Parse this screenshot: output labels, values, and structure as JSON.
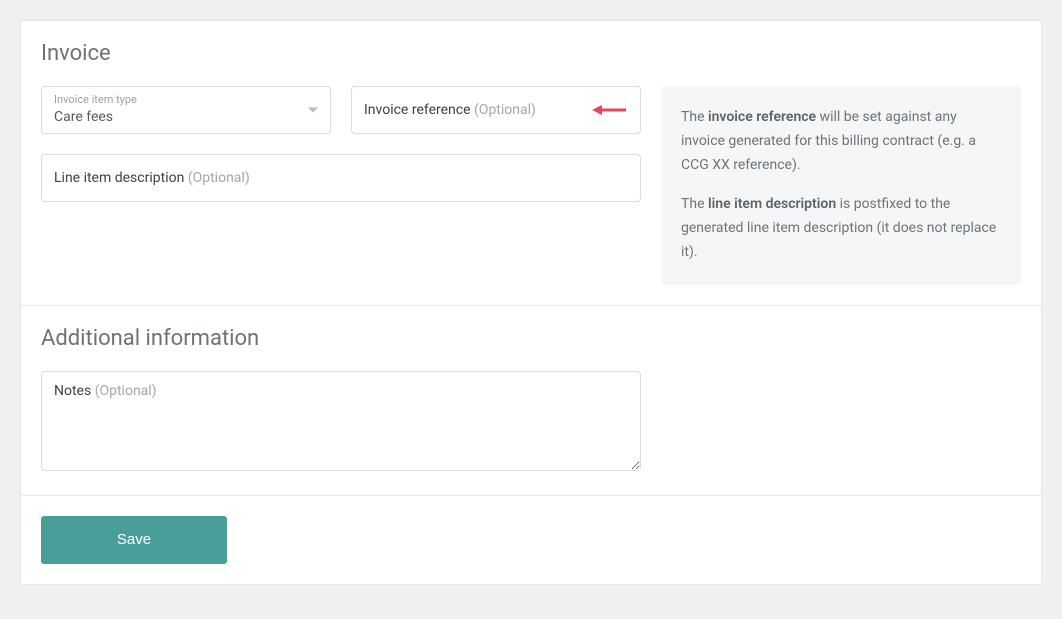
{
  "invoice": {
    "title": "Invoice",
    "item_type": {
      "label": "Invoice item type",
      "value": "Care fees"
    },
    "reference": {
      "label": "Invoice reference",
      "optional": "(Optional)",
      "value": ""
    },
    "line_item_desc": {
      "label": "Line item description",
      "optional": "(Optional)",
      "value": ""
    },
    "help": {
      "p1_pre": "The ",
      "p1_strong": "invoice reference",
      "p1_post": " will be set against any invoice generated for this billing contract (e.g. a CCG XX reference).",
      "p2_pre": "The ",
      "p2_strong": "line item description",
      "p2_post": " is postfixed to the generated line item description (it does not replace it)."
    }
  },
  "additional": {
    "title": "Additional information",
    "notes": {
      "label": "Notes",
      "optional": "(Optional)",
      "value": ""
    }
  },
  "actions": {
    "save": "Save"
  },
  "colors": {
    "accent": "#4a9e9a",
    "annotation": "#e8445a"
  }
}
